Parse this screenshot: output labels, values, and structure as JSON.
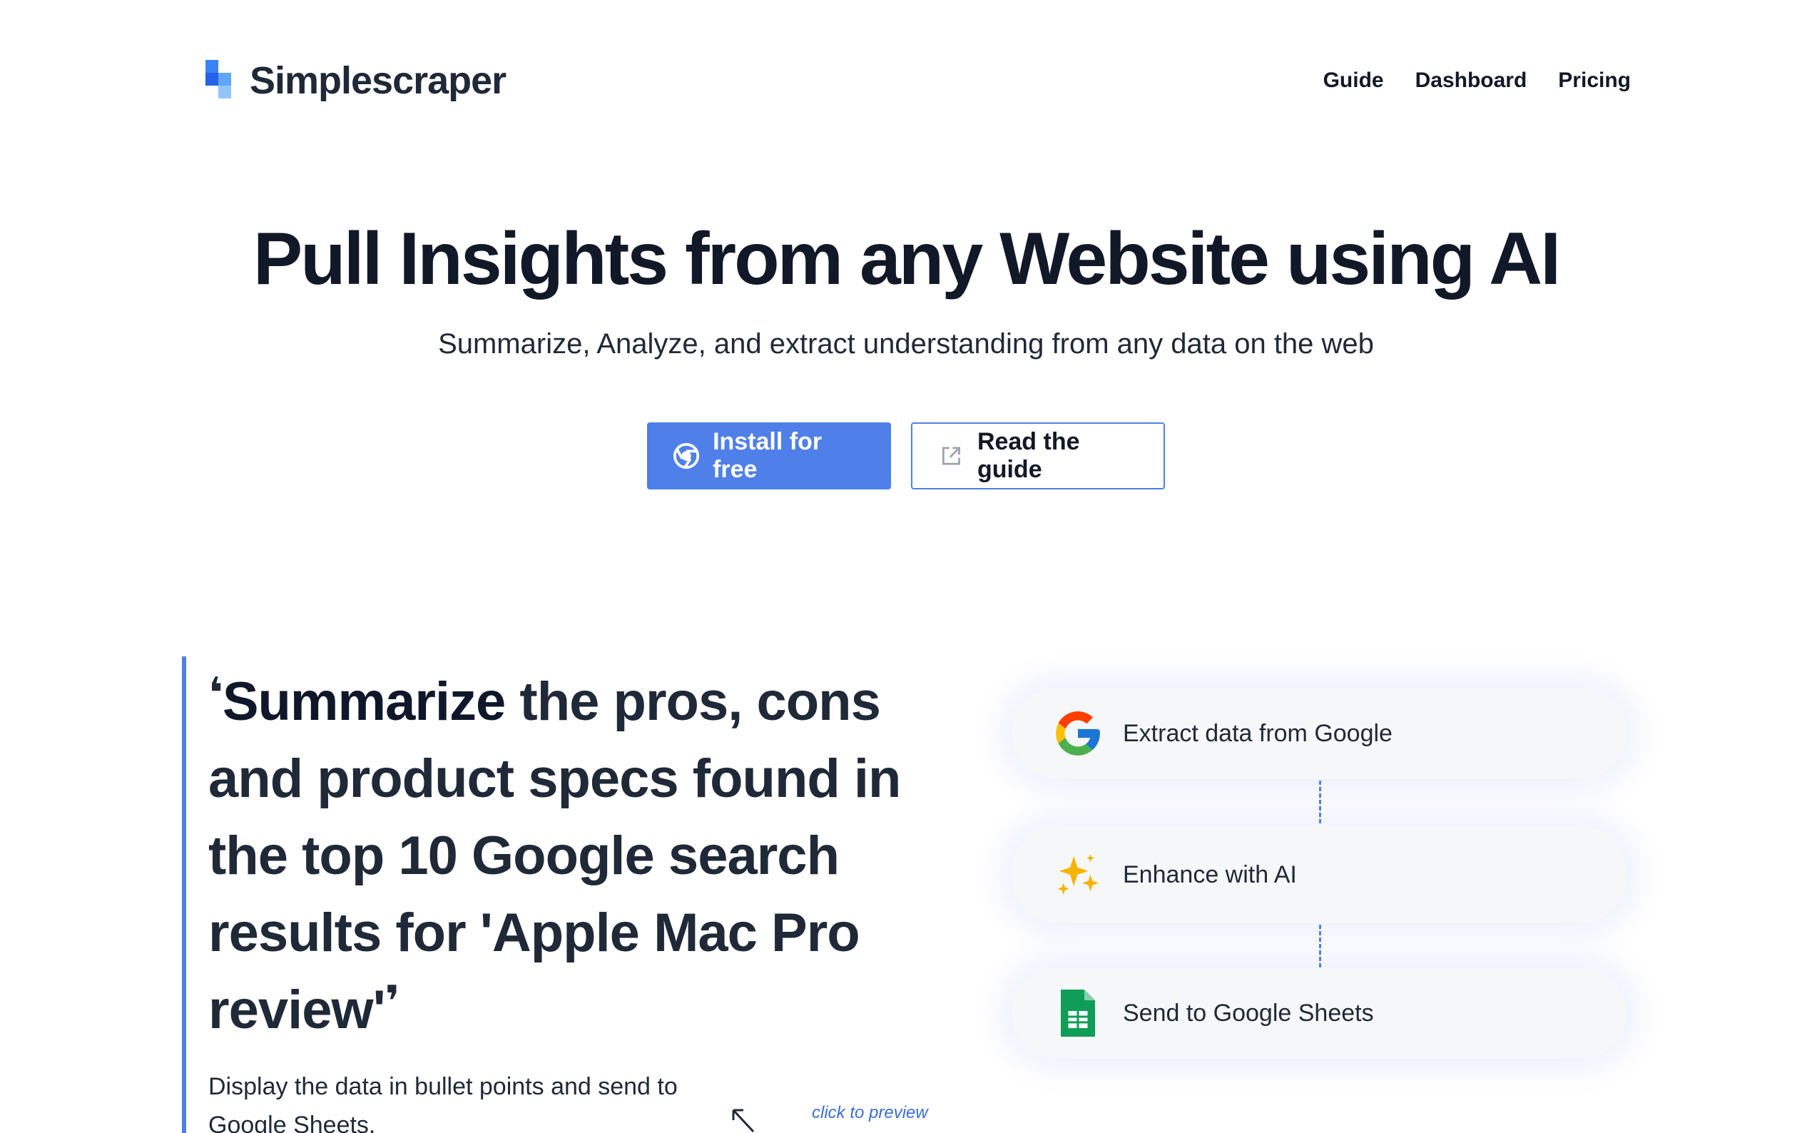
{
  "brand": {
    "name": "Simplescraper"
  },
  "nav": {
    "guide": "Guide",
    "dashboard": "Dashboard",
    "pricing": "Pricing"
  },
  "hero": {
    "title": "Pull Insights from any Website using AI",
    "subtitle": "Summarize, Analyze, and extract understanding from any data on the web",
    "install_label": "Install for free",
    "guide_label": "Read the guide"
  },
  "quote": {
    "open_mark": "❛",
    "emphasis": "Summarize",
    "rest": " the pros, cons and product specs found in the top 10 Google search results for 'Apple Mac Pro review'",
    "close_mark": "❜",
    "note": "Display the data in bullet points and send to Google Sheets.",
    "preview_hint": "click to preview"
  },
  "flow": {
    "step1": "Extract data from Google",
    "step2": "Enhance with AI",
    "step3": "Send to Google Sheets"
  },
  "icons": {
    "logo": "simplescraper-logo-icon",
    "chrome": "chrome-icon",
    "external": "external-link-icon",
    "google": "google-icon",
    "sparkles": "sparkles-icon",
    "sheets": "google-sheets-icon",
    "arrow": "arrow-icon"
  },
  "colors": {
    "accent": "#4f7fe8",
    "text": "#111827"
  }
}
